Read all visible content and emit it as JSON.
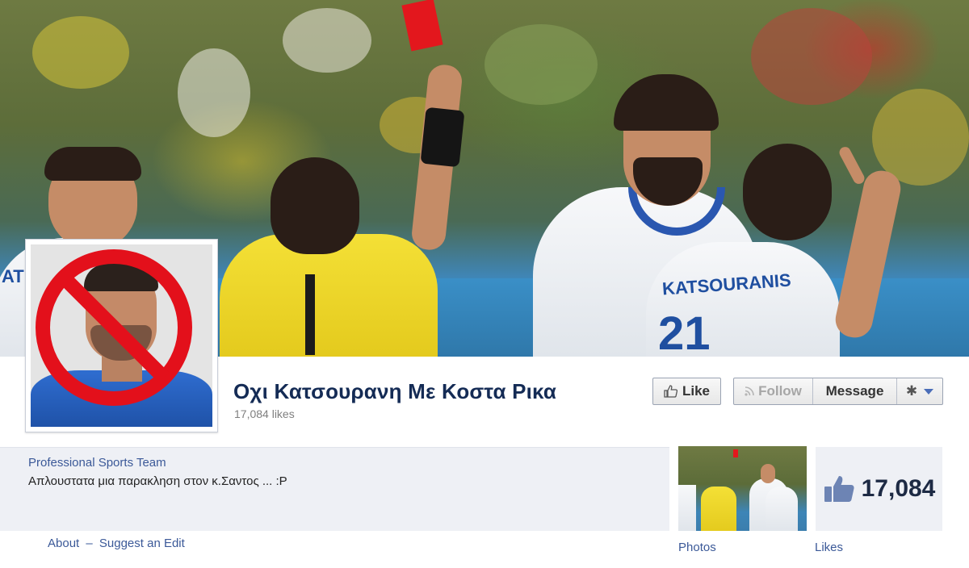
{
  "page": {
    "name": "Οχι Κατσουρανη Με Κοστα Ρικα",
    "likes_text": "17,084 likes",
    "category": "Professional Sports Team",
    "about_text": "Απλουστατα μια παρακληση στον κ.Σαντος ... :P"
  },
  "actions": {
    "like_label": "Like",
    "follow_label": "Follow",
    "message_label": "Message"
  },
  "links": {
    "about": "About",
    "separator": "–",
    "suggest_edit": "Suggest an Edit"
  },
  "tiles": {
    "photos_label": "Photos",
    "likes_label": "Likes",
    "likes_count": "17,084"
  },
  "cover_jersey": {
    "name_left": "ATIS",
    "name_right": "KATSOURANIS",
    "number": "21"
  },
  "icons": {
    "like": "thumbs-up-icon",
    "follow": "rss-icon",
    "settings": "gear-icon",
    "dropdown": "chevron-down-icon"
  },
  "colors": {
    "link_blue": "#3b5998",
    "title_navy": "#142b55",
    "ban_red": "#e3101b",
    "panel_bg": "#eef0f5"
  }
}
